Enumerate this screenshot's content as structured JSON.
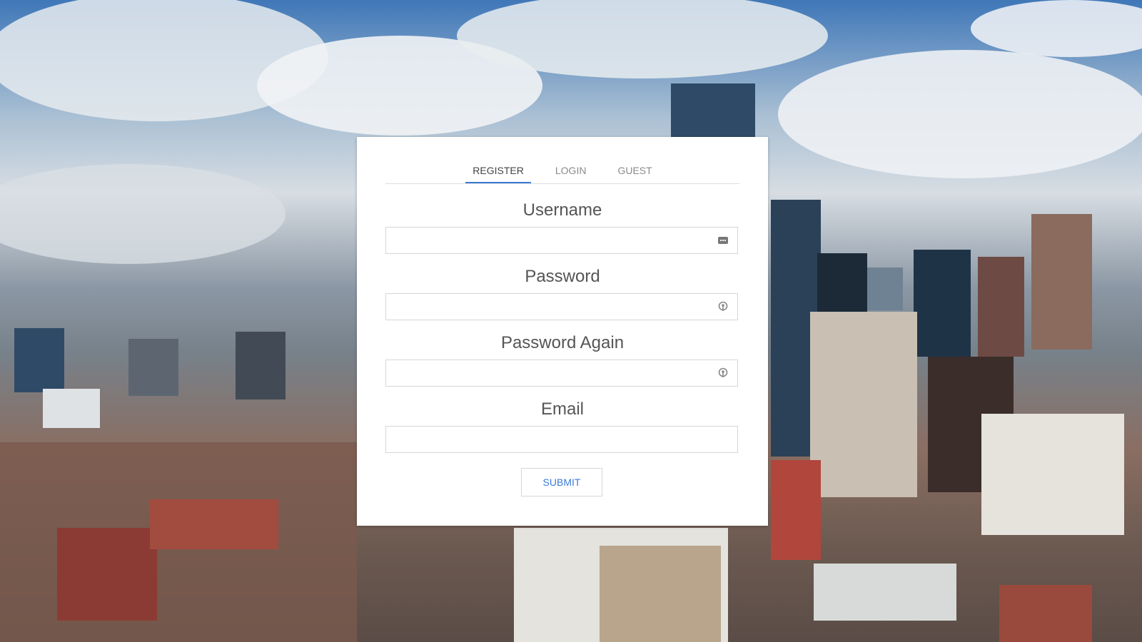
{
  "tabs": [
    {
      "label": "REGISTER",
      "active": true
    },
    {
      "label": "LOGIN",
      "active": false
    },
    {
      "label": "GUEST",
      "active": false
    }
  ],
  "form": {
    "username_label": "Username",
    "password_label": "Password",
    "password_again_label": "Password Again",
    "email_label": "Email",
    "username_value": "",
    "password_value": "",
    "password_again_value": "",
    "email_value": "",
    "submit_label": "SUBMIT"
  },
  "icons": {
    "username_field_icon": "autofill-dots-icon",
    "password_field_icon": "key-icon",
    "password_again_field_icon": "key-icon"
  },
  "colors": {
    "accent": "#3a7bd5",
    "card_bg": "#ffffff"
  }
}
